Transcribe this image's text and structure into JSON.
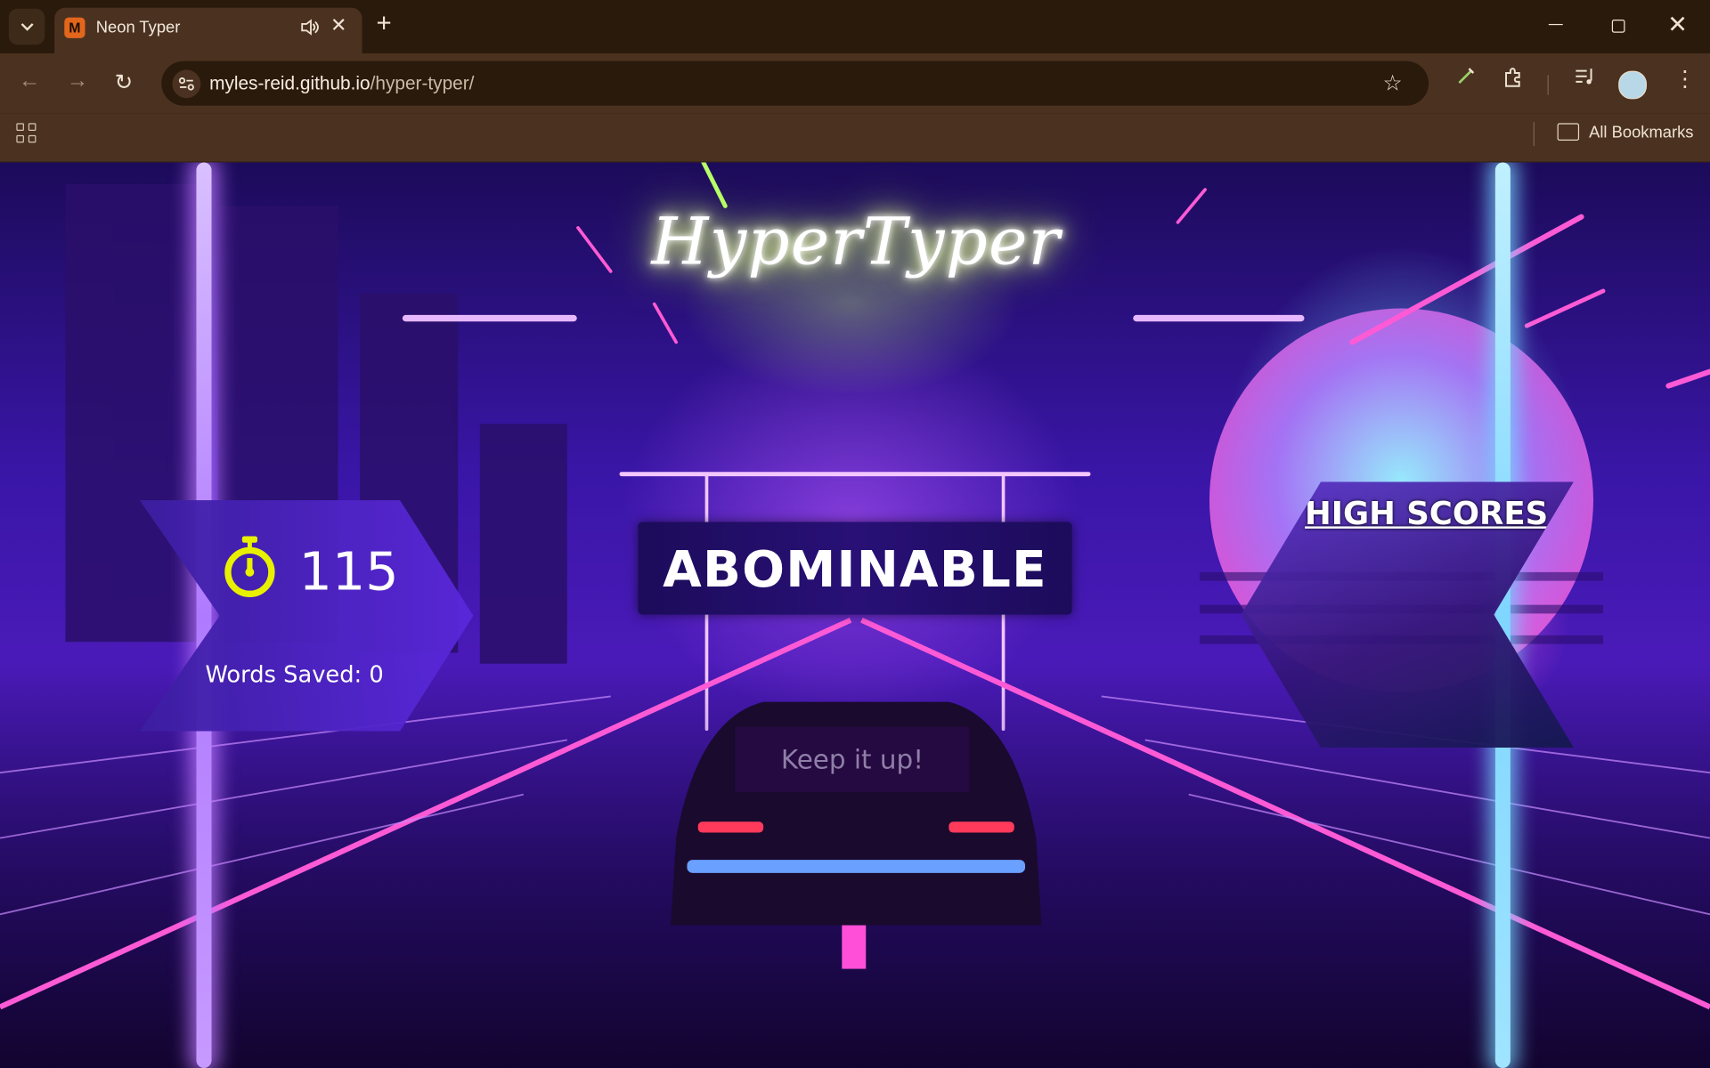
{
  "browser": {
    "tab_title": "Neon Typer",
    "tab_favicon_letter": "M",
    "url_host": "myles-reid.github.io",
    "url_path": "/hyper-typer/",
    "bookmarks_label": "All Bookmarks"
  },
  "game": {
    "logo": "HyperTyper",
    "timer": "115",
    "words_saved": "Words Saved: 0",
    "current_word": "ABOMINABLE",
    "input_placeholder": "Keep it up!",
    "high_scores_title": "HIGH SCORES"
  },
  "icons": {
    "timer": "stopwatch-icon"
  },
  "colors": {
    "stopwatch": "#e8f000",
    "neon_pink": "#ff4fd8",
    "neon_purple": "#7a3cff"
  }
}
